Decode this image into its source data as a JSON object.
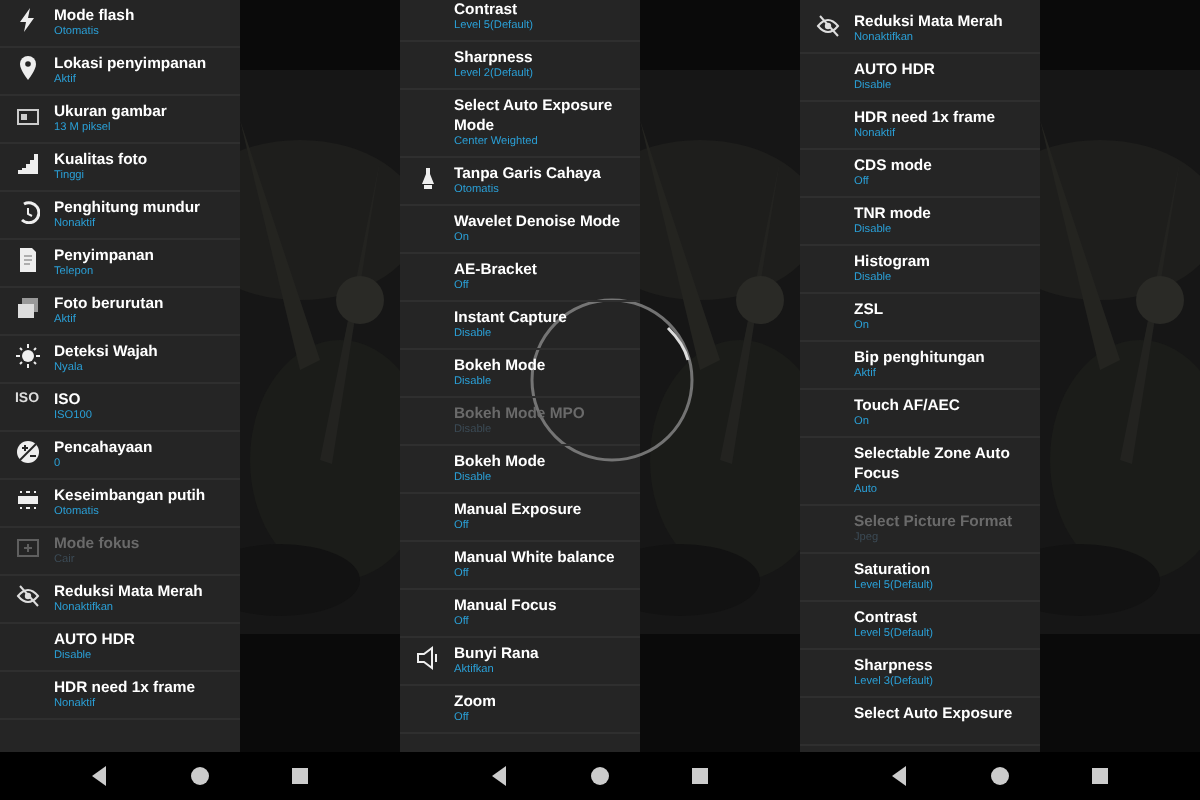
{
  "screens": [
    {
      "settings": [
        {
          "title": "Mode flash",
          "value": "Otomatis",
          "kind": "flash",
          "disabled": false
        },
        {
          "title": "Lokasi penyimpanan",
          "value": "Aktif",
          "kind": "pin",
          "disabled": false
        },
        {
          "title": "Ukuran gambar",
          "value": "13 M piksel",
          "kind": "frame",
          "disabled": false
        },
        {
          "title": "Kualitas foto",
          "value": "Tinggi",
          "kind": "steps",
          "disabled": false
        },
        {
          "title": "Penghitung mundur",
          "value": "Nonaktif",
          "kind": "timer",
          "disabled": false
        },
        {
          "title": "Penyimpanan",
          "value": "Telepon",
          "kind": "card",
          "disabled": false
        },
        {
          "title": "Foto berurutan",
          "value": "Aktif",
          "kind": "stack",
          "disabled": false
        },
        {
          "title": "Deteksi Wajah",
          "value": "Nyala",
          "kind": "sun",
          "disabled": false
        },
        {
          "title": "ISO",
          "value": "ISO100",
          "kind": "label",
          "icon_text": "ISO",
          "disabled": false
        },
        {
          "title": "Pencahayaan",
          "value": "0",
          "kind": "exposure",
          "disabled": false
        },
        {
          "title": "Keseimbangan putih",
          "value": "Otomatis",
          "kind": "balance",
          "disabled": false
        },
        {
          "title": "Mode fokus",
          "value": "Cair",
          "kind": "focus",
          "disabled": true
        },
        {
          "title": "Reduksi Mata Merah",
          "value": "Nonaktifkan",
          "kind": "eye",
          "disabled": false
        },
        {
          "title": "AUTO HDR",
          "value": "Disable",
          "kind": "plain",
          "disabled": false
        },
        {
          "title": "HDR need 1x frame",
          "value": "Nonaktif",
          "kind": "plain",
          "disabled": false
        }
      ]
    },
    {
      "settings": [
        {
          "title": "Contrast",
          "value": "Level 5(Default)",
          "kind": "plain",
          "disabled": false
        },
        {
          "title": "Sharpness",
          "value": "Level 2(Default)",
          "kind": "plain",
          "disabled": false
        },
        {
          "title": "Select Auto Exposure Mode",
          "value": "Center Weighted",
          "kind": "plain",
          "disabled": false
        },
        {
          "title": "Tanpa Garis Cahaya",
          "value": "Otomatis",
          "kind": "bulb",
          "disabled": false
        },
        {
          "title": "Wavelet Denoise Mode",
          "value": "On",
          "kind": "plain",
          "disabled": false
        },
        {
          "title": "AE-Bracket",
          "value": "Off",
          "kind": "plain",
          "disabled": false
        },
        {
          "title": "Instant Capture",
          "value": "Disable",
          "kind": "plain",
          "disabled": false
        },
        {
          "title": "Bokeh Mode",
          "value": "Disable",
          "kind": "plain",
          "disabled": false
        },
        {
          "title": "Bokeh Mode MPO",
          "value": "Disable",
          "kind": "plain",
          "disabled": true
        },
        {
          "title": "Bokeh Mode",
          "value": "Disable",
          "kind": "plain",
          "disabled": false
        },
        {
          "title": "Manual Exposure",
          "value": "Off",
          "kind": "plain",
          "disabled": false
        },
        {
          "title": "Manual White balance",
          "value": "Off",
          "kind": "plain",
          "disabled": false
        },
        {
          "title": "Manual Focus",
          "value": "Off",
          "kind": "plain",
          "disabled": false
        },
        {
          "title": "Bunyi Rana",
          "value": "Aktifkan",
          "kind": "speaker",
          "disabled": false
        },
        {
          "title": "Zoom",
          "value": "Off",
          "kind": "plain",
          "disabled": false
        }
      ]
    },
    {
      "settings": [
        {
          "title": "Reduksi Mata Merah",
          "value": "Nonaktifkan",
          "kind": "eye",
          "disabled": false
        },
        {
          "title": "AUTO HDR",
          "value": "Disable",
          "kind": "plain",
          "disabled": false
        },
        {
          "title": "HDR need 1x frame",
          "value": "Nonaktif",
          "kind": "plain",
          "disabled": false
        },
        {
          "title": "CDS mode",
          "value": "Off",
          "kind": "plain",
          "disabled": false
        },
        {
          "title": "TNR mode",
          "value": "Disable",
          "kind": "plain",
          "disabled": false
        },
        {
          "title": "Histogram",
          "value": "Disable",
          "kind": "plain",
          "disabled": false
        },
        {
          "title": "ZSL",
          "value": "On",
          "kind": "plain",
          "disabled": false
        },
        {
          "title": "Bip penghitungan",
          "value": "Aktif",
          "kind": "plain",
          "disabled": false
        },
        {
          "title": "Touch AF/AEC",
          "value": "On",
          "kind": "plain",
          "disabled": false
        },
        {
          "title": "Selectable Zone Auto Focus",
          "value": "Auto",
          "kind": "plain",
          "disabled": false
        },
        {
          "title": "Select Picture Format",
          "value": "Jpeg",
          "kind": "plain",
          "disabled": true
        },
        {
          "title": "Saturation",
          "value": "Level 5(Default)",
          "kind": "plain",
          "disabled": false
        },
        {
          "title": "Contrast",
          "value": "Level 5(Default)",
          "kind": "plain",
          "disabled": false
        },
        {
          "title": "Sharpness",
          "value": "Level 3(Default)",
          "kind": "plain",
          "disabled": false
        },
        {
          "title": "Select Auto Exposure",
          "kind": "plain",
          "disabled": false
        }
      ]
    }
  ]
}
